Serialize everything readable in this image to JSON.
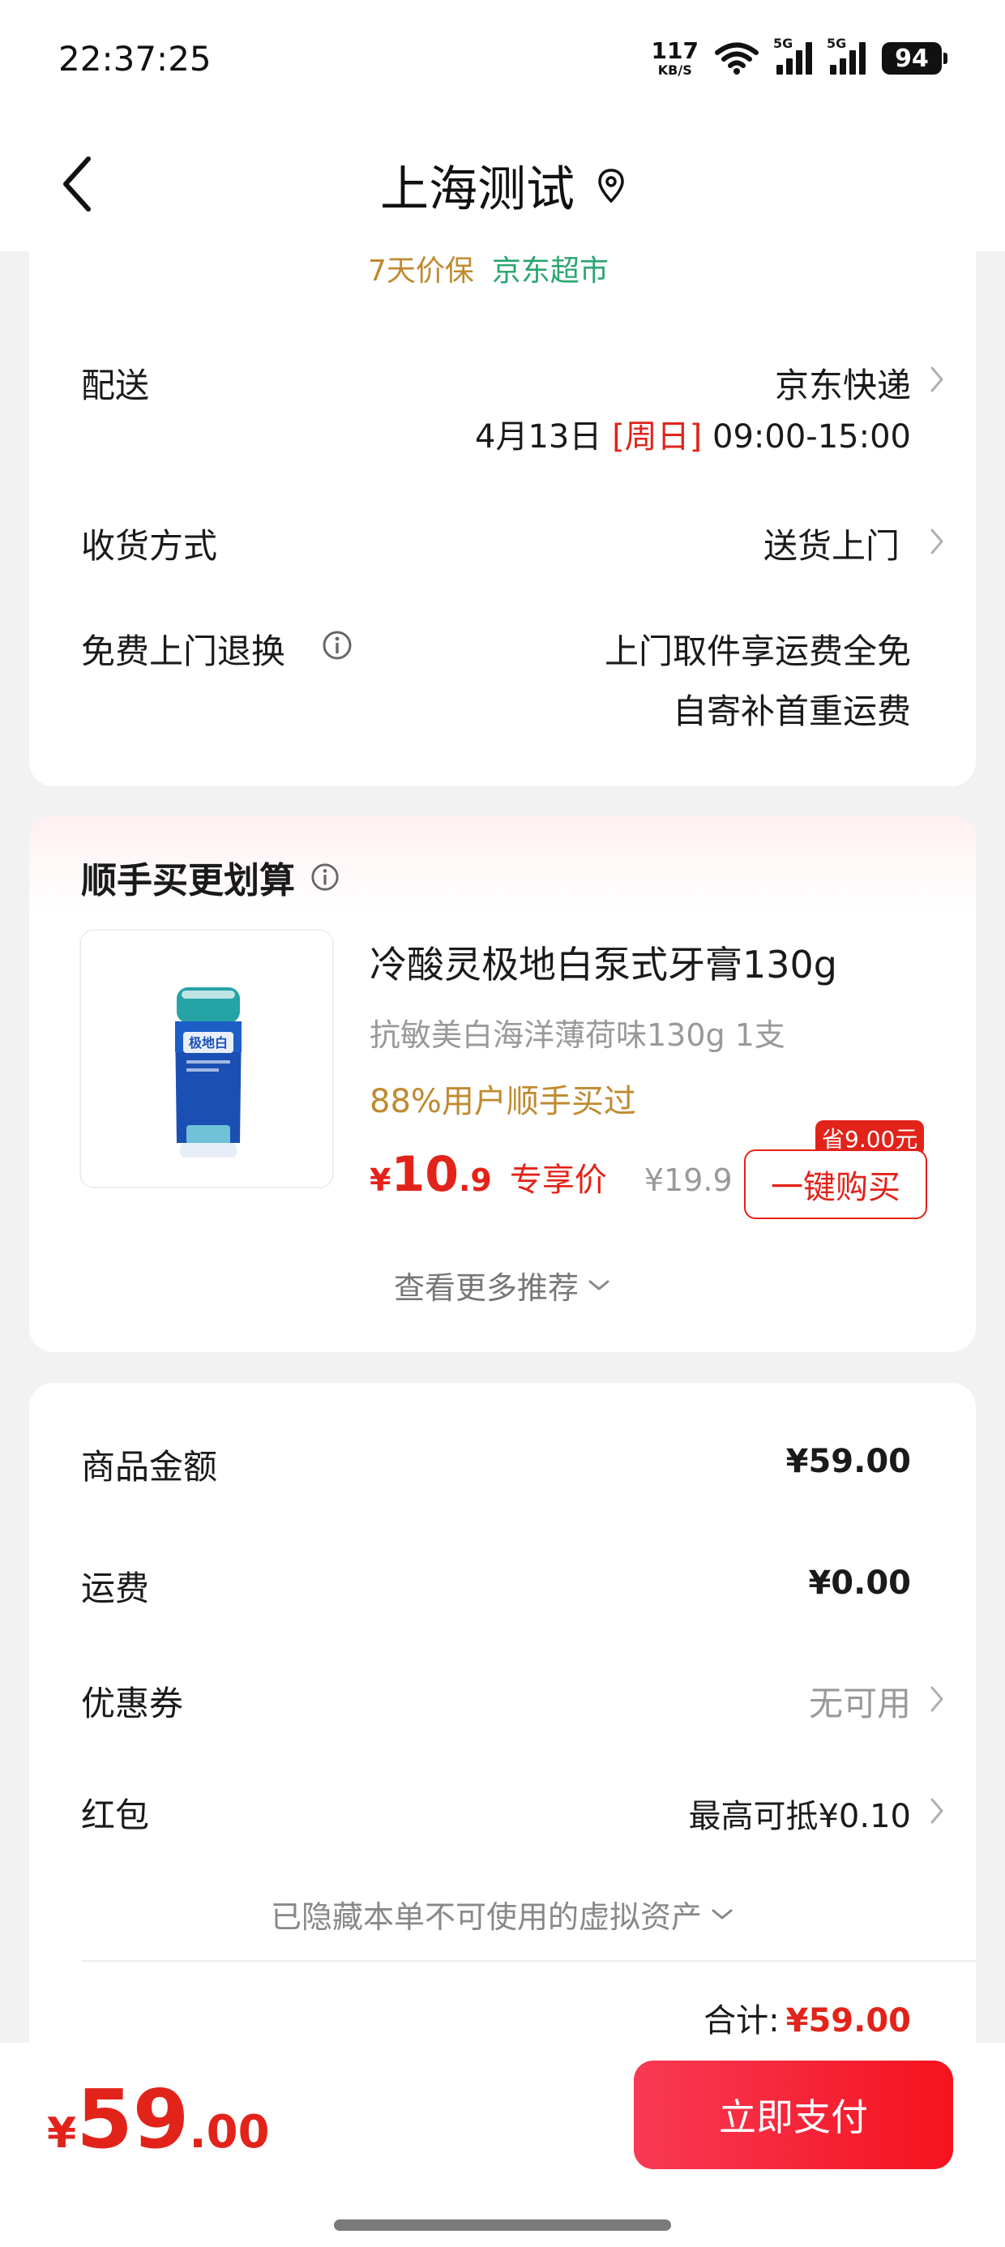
{
  "status": {
    "time": "22:37:25",
    "net_speed": "117",
    "net_unit": "KB/S",
    "sig1_tag": "5G",
    "sig2_tag": "5G",
    "battery": "94"
  },
  "header": {
    "title": "上海测试"
  },
  "product_tags": {
    "price_protect": "7天价保",
    "jd_market": "京东超市"
  },
  "delivery": {
    "label": "配送",
    "carrier": "京东快递",
    "date": "4月13日",
    "weekday": "[周日]",
    "window": "09:00-15:00"
  },
  "receive": {
    "label": "收货方式",
    "value": "送货上门"
  },
  "free_return": {
    "label": "免费上门退换",
    "line1": "上门取件享运费全免",
    "line2": "自寄补首重运费"
  },
  "addon": {
    "title": "顺手买更划算",
    "product": {
      "name": "冷酸灵极地白泵式牙膏130g",
      "desc": "抗敏美白海洋薄荷味130g 1支",
      "social": "88%用户顺手买过",
      "currency": "¥",
      "price_int": "10",
      "price_dec": ".9",
      "price_label": "专享价",
      "orig_price": "¥19.9",
      "save_badge": "省9.00元",
      "buy_label": "一键购买",
      "tube_brand": "极地白"
    },
    "more": "查看更多推荐"
  },
  "summary": {
    "goods_label": "商品金额",
    "goods_value": "¥59.00",
    "freight_label": "运费",
    "freight_value": "¥0.00",
    "coupon_label": "优惠券",
    "coupon_value": "无可用",
    "redpack_label": "红包",
    "redpack_value": "最高可抵¥0.10",
    "hidden_note": "已隐藏本单不可使用的虚拟资产",
    "total_label": "合计:",
    "total_value": "¥59.00"
  },
  "footer": {
    "currency": "¥",
    "amount_int": "59",
    "amount_dec": ".00",
    "pay_label": "立即支付"
  },
  "colors": {
    "accent": "#e2231a",
    "green": "#2aa66f",
    "gold": "#c08a2f"
  }
}
